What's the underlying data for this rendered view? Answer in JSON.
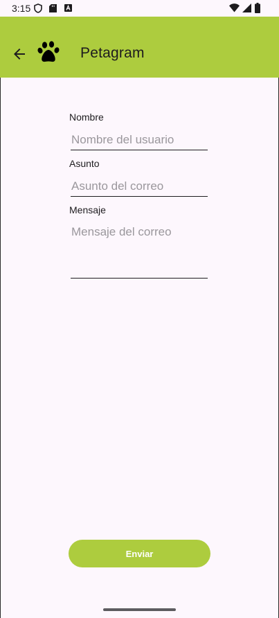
{
  "status_bar": {
    "time": "3:15",
    "left_icons": [
      "shield-icon",
      "sd-card-icon",
      "keyboard-icon"
    ],
    "right_icons": [
      "wifi-icon",
      "cell-signal-icon",
      "battery-icon"
    ]
  },
  "app_bar": {
    "title": "Petagram",
    "back_icon": "arrow-back-icon",
    "logo_icon": "paw-icon",
    "background": "#ADCC3E"
  },
  "form": {
    "name": {
      "label": "Nombre",
      "placeholder": "Nombre del usuario",
      "value": ""
    },
    "subject": {
      "label": "Asunto",
      "placeholder": "Asunto del correo",
      "value": ""
    },
    "message": {
      "label": "Mensaje",
      "placeholder": "Mensaje del correo",
      "value": ""
    },
    "submit_label": "Enviar"
  },
  "colors": {
    "accent": "#ADCC3E",
    "background": "#FDF7FD",
    "text": "#1D1B1E",
    "placeholder": "#9A979C"
  }
}
